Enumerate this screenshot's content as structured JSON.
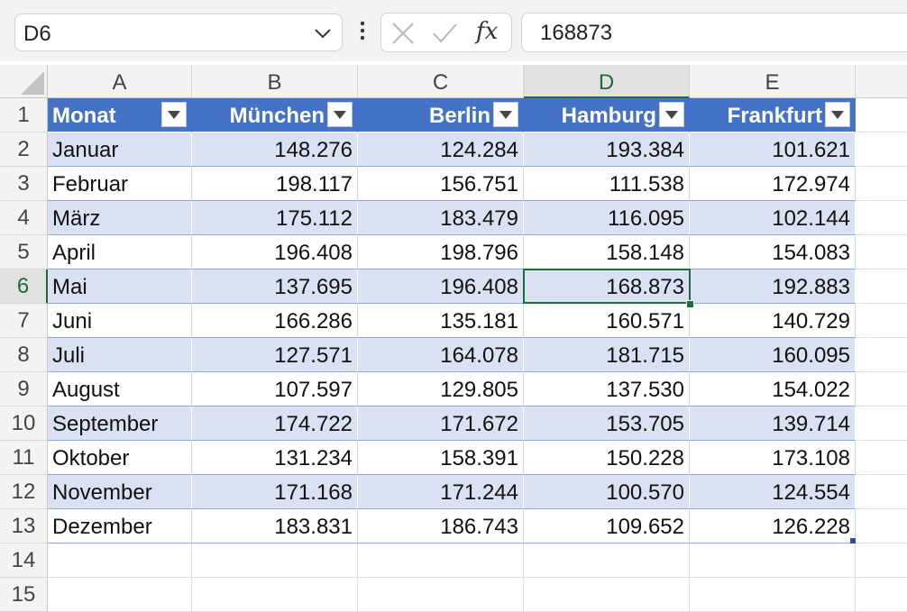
{
  "name_box": {
    "value": "D6"
  },
  "formula_bar": {
    "fx_label": "fx",
    "value": "168873"
  },
  "columns": [
    "A",
    "B",
    "C",
    "D",
    "E"
  ],
  "rows": [
    "1",
    "2",
    "3",
    "4",
    "5",
    "6",
    "7",
    "8",
    "9",
    "10",
    "11",
    "12",
    "13",
    "14",
    "15"
  ],
  "table": {
    "headers": [
      "Monat",
      "München",
      "Berlin",
      "Hamburg",
      "Frankfurt"
    ],
    "body": [
      [
        "Januar",
        "148.276",
        "124.284",
        "193.384",
        "101.621"
      ],
      [
        "Februar",
        "198.117",
        "156.751",
        "111.538",
        "172.974"
      ],
      [
        "März",
        "175.112",
        "183.479",
        "116.095",
        "102.144"
      ],
      [
        "April",
        "196.408",
        "198.796",
        "158.148",
        "154.083"
      ],
      [
        "Mai",
        "137.695",
        "196.408",
        "168.873",
        "192.883"
      ],
      [
        "Juni",
        "166.286",
        "135.181",
        "160.571",
        "140.729"
      ],
      [
        "Juli",
        "127.571",
        "164.078",
        "181.715",
        "160.095"
      ],
      [
        "August",
        "107.597",
        "129.805",
        "137.530",
        "154.022"
      ],
      [
        "September",
        "174.722",
        "171.672",
        "153.705",
        "139.714"
      ],
      [
        "Oktober",
        "131.234",
        "158.391",
        "150.228",
        "173.108"
      ],
      [
        "November",
        "171.168",
        "171.244",
        "100.570",
        "124.554"
      ],
      [
        "Dezember",
        "183.831",
        "186.743",
        "109.652",
        "126.228"
      ]
    ]
  },
  "active_cell": {
    "column": "D",
    "row": "6"
  },
  "colors": {
    "table_header": "#4472c4",
    "band": "#d9e1f2",
    "selection": "#1e6b3c"
  },
  "icons": {
    "name_box_dropdown": "chevron-down-icon",
    "more": "more-vertical-icon",
    "cancel": "cancel-x-icon",
    "enter": "enter-check-icon",
    "function": "insert-function-icon",
    "filter": "filter-dropdown-icon"
  }
}
